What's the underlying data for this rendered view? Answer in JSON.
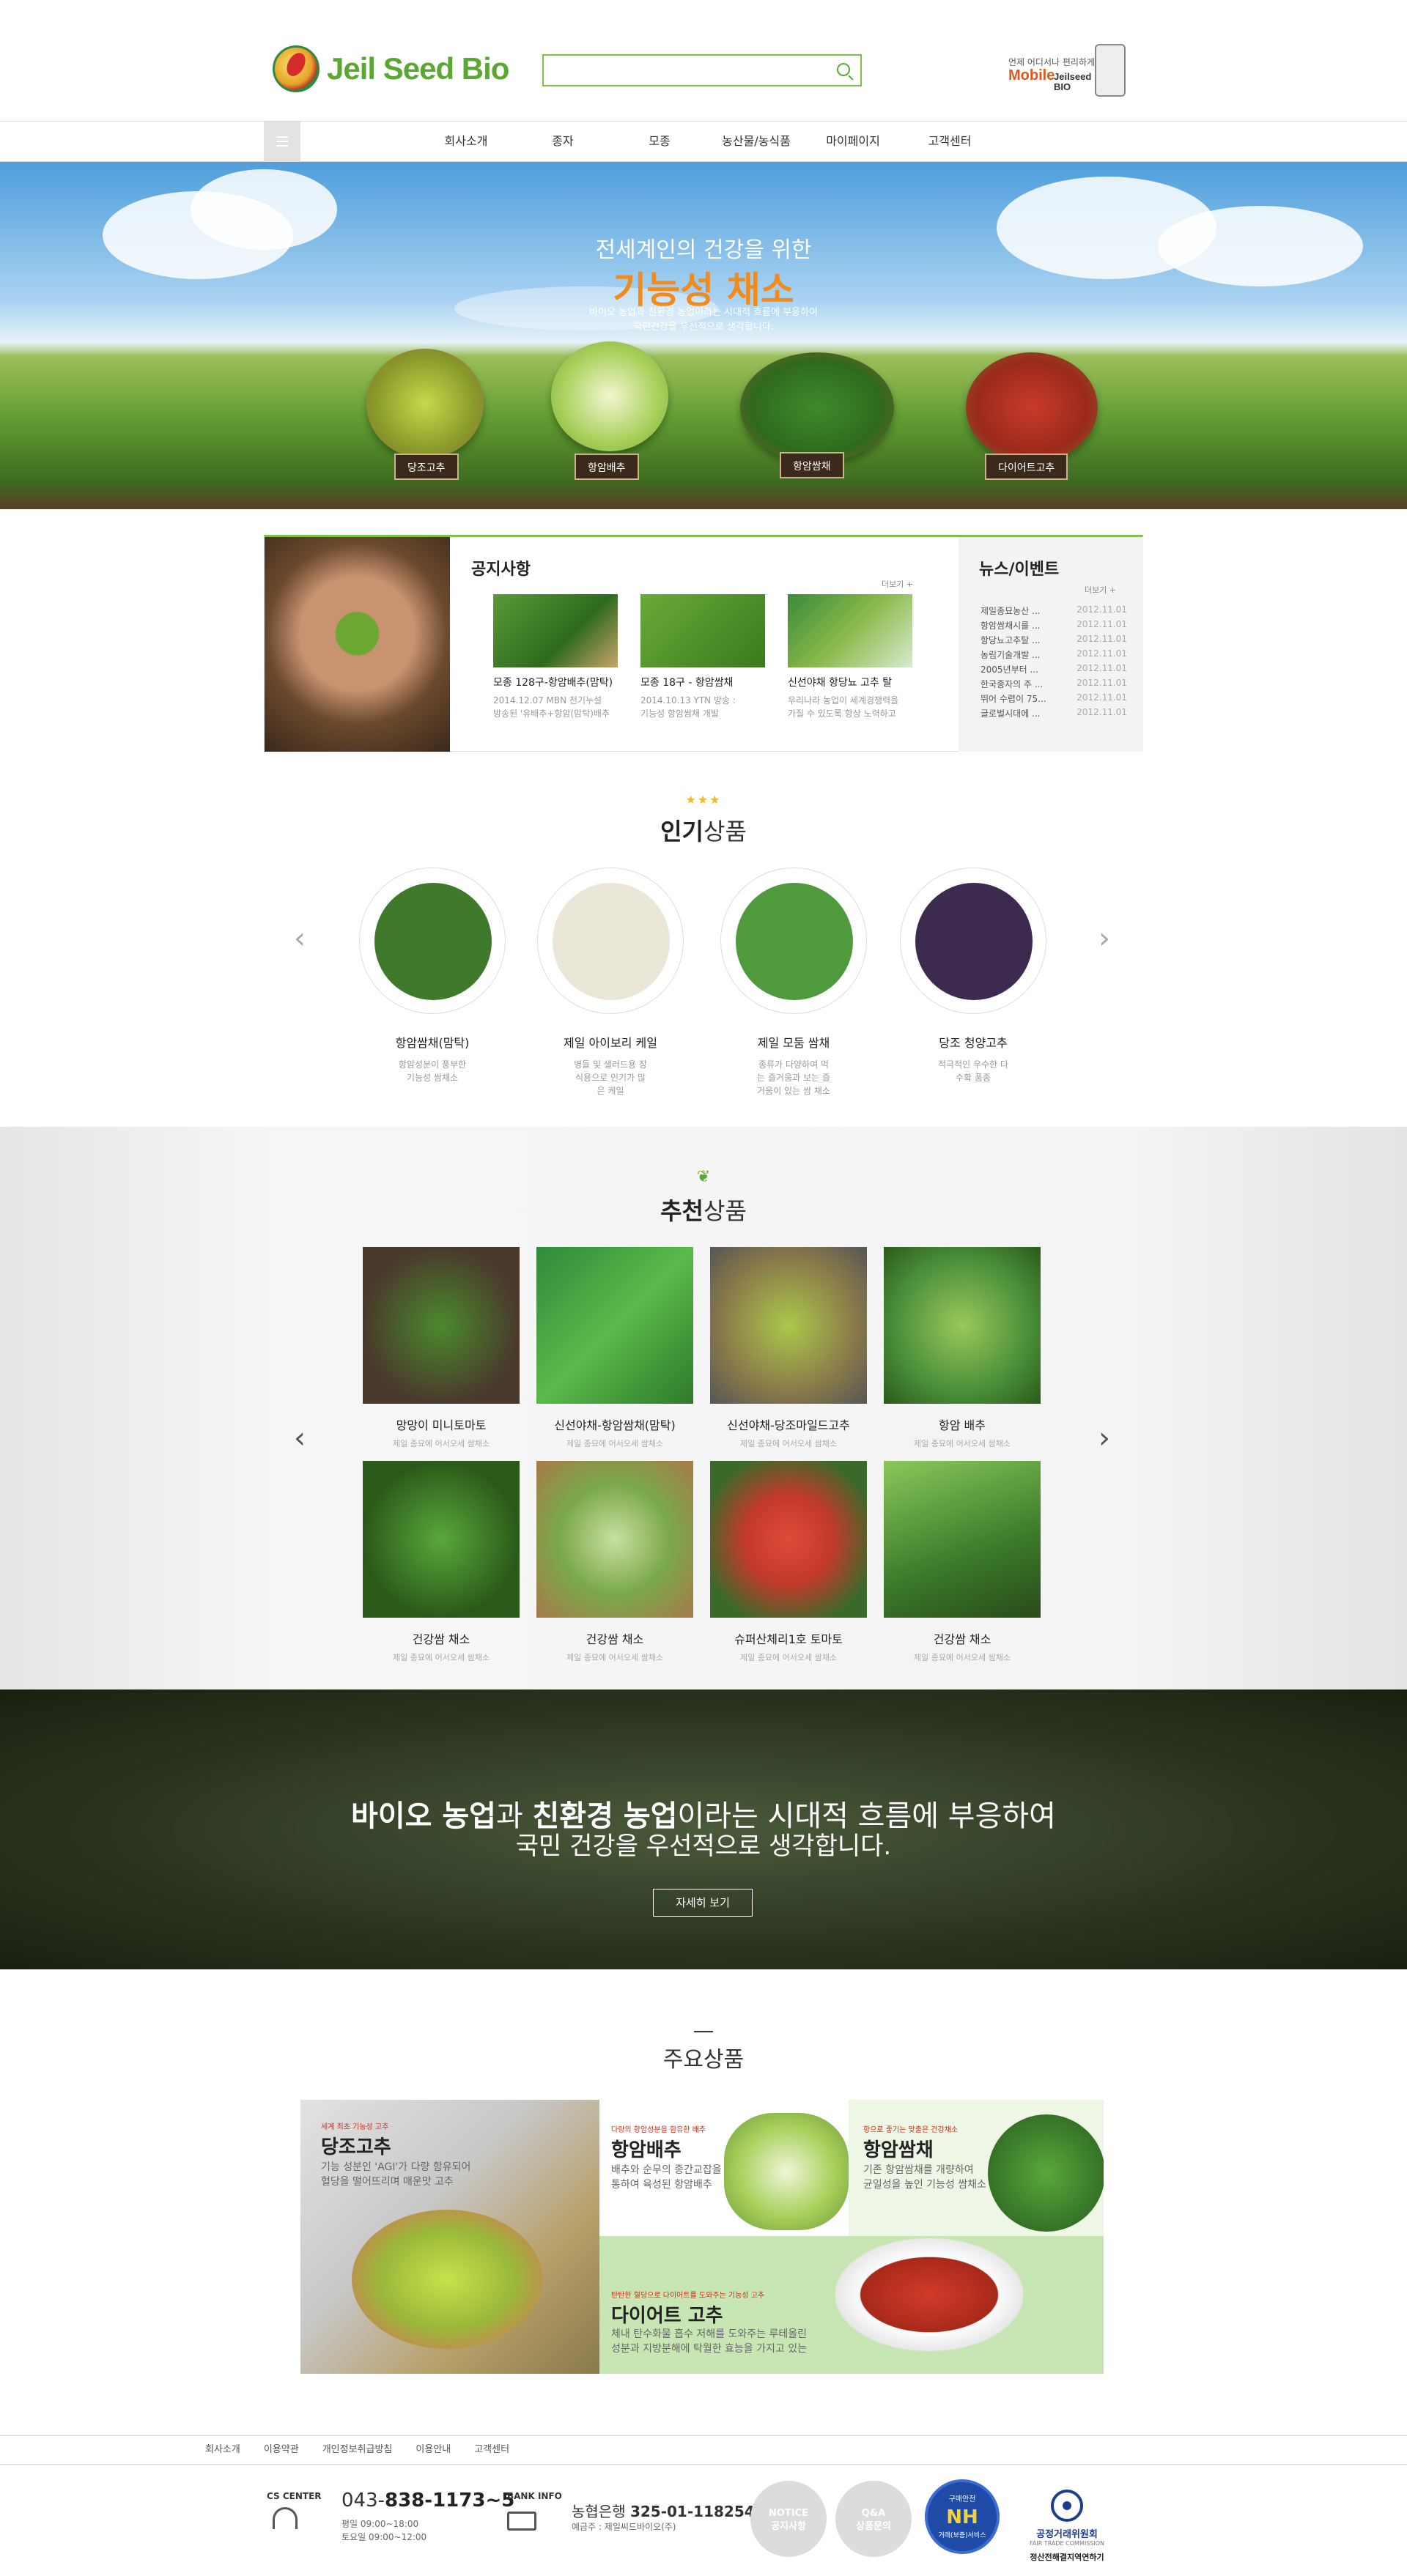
{
  "header": {
    "logo_text": "Jeil Seed Bio",
    "search_placeholder": "",
    "mobile": {
      "line1": "언제 어디서나 편리하게",
      "line2": "Mobile",
      "line3": "Jeilseed BIO"
    }
  },
  "nav": {
    "items": [
      "회사소개",
      "종자",
      "모종",
      "농산물/농식품",
      "마이페이지",
      "고객센터"
    ]
  },
  "hero": {
    "subtitle": "전세계인의 건강을 위한",
    "title": "기능성 채소",
    "desc1": "바이오 농업과 친환경 농업이라는 시대적 흐름에 부응하여",
    "desc2": "국민건강을 우선적으로 생각합니다.",
    "veg_labels": [
      "당조고추",
      "항암배추",
      "항암쌈채",
      "다이어트고추"
    ]
  },
  "notice": {
    "title": "공지사항",
    "more": "더보기 +",
    "cards": [
      {
        "title": "모종 128구-항암배추(맘탁)",
        "desc1": "2014.12.07 MBN 천기누설",
        "desc2": "방송된 '유배추+항암(맘탁)배추"
      },
      {
        "title": "모종 18구 - 항암쌈채",
        "desc1": "2014.10.13 YTN 방송 :",
        "desc2": "기능성 항암쌈채 개발"
      },
      {
        "title": "신선야채 항당뇨 고추 탈",
        "desc1": "우리나라 농업이 세계경쟁력을",
        "desc2": "가질 수 있도록 항상 노력하고"
      }
    ]
  },
  "news": {
    "title": "뉴스/이벤트",
    "more": "더보기 +",
    "items": [
      {
        "text": "제일종묘농산 ...",
        "date": "2012.11.01"
      },
      {
        "text": "항암쌈채시를 ...",
        "date": "2012.11.01"
      },
      {
        "text": "항당뇨고추탈 ...",
        "date": "2012.11.01"
      },
      {
        "text": "농림기술개발 ...",
        "date": "2012.11.01"
      },
      {
        "text": "2005년부터 ...",
        "date": "2012.11.01"
      },
      {
        "text": "한국종자의 주 ...",
        "date": "2012.11.01"
      },
      {
        "text": "뛰어 수렵이 75...",
        "date": "2012.11.01"
      },
      {
        "text": "글로벌시대에 ...",
        "date": "2012.11.01"
      }
    ]
  },
  "popular": {
    "title_bold": "인기",
    "title_rest": "상품",
    "items": [
      {
        "name": "항암쌈채(맘탁)",
        "desc": "항암성분이 풍부한 기능성 쌈채소",
        "color": "#3f7a2c"
      },
      {
        "name": "제일 아이보리 케일",
        "desc": "병들 및 샐러드용 장식용으로 인기가 많은 케일",
        "color": "#eae6d8"
      },
      {
        "name": "제일 모둠 쌈채",
        "desc": "종류가 다양하여 먹는 즐거움과 보는 즐거움이 있는 쌈 채소",
        "color": "#4f9a3c"
      },
      {
        "name": "당조 청양고추",
        "desc": "적극적인 우수한 다수확 품종",
        "color": "#3d2a4f"
      }
    ]
  },
  "recommend": {
    "title_bold": "추천",
    "title_rest": "상품",
    "sub": "제일 종묘에 어서오세 쌈채소",
    "items": [
      {
        "name": "망망이 미니토마토",
        "color": "#4a3a2c"
      },
      {
        "name": "신선야채-항암쌈채(맘탁)",
        "color": "#2e8a3a"
      },
      {
        "name": "신선야채-당조마일드고추",
        "color": "#8aa23a"
      },
      {
        "name": "항암 배추",
        "color": "#4a8f3a"
      },
      {
        "name": "건강쌈 채소",
        "color": "#3c7a2a"
      },
      {
        "name": "건강쌈 채소",
        "color": "#7aa84a"
      },
      {
        "name": "슈퍼산체리1호 토마토",
        "color": "#c23a2a"
      },
      {
        "name": "건강쌈 채소",
        "color": "#5a9a3a"
      }
    ]
  },
  "banner": {
    "bold1": "바이오 농업",
    "mid1": "과 ",
    "bold2": "친환경 농업",
    "rest1": "이라는 시대적 흐름에 부응하여",
    "line2": "국민 건강을 우선적으로 생각합니다.",
    "button": "자세히 보기"
  },
  "main_products": {
    "title": "주요상품",
    "items": [
      {
        "tag": "세계 최초 기능성 고추",
        "name": "당조고추",
        "desc1": "기능 성분인 'AGI'가 다량 함유되어",
        "desc2": "혈당을 떨어뜨리며 매운맛 고추"
      },
      {
        "tag": "다량의 항암성분을 함유한 배추",
        "name": "항암배추",
        "desc1": "배추와 순무의 종간교잡을",
        "desc2": "통하여 육성된 항암배추"
      },
      {
        "tag": "항으로 좋기는 맞출은 건강채소",
        "name": "항암쌈채",
        "desc1": "기존 항암쌈채를 개량하여",
        "desc2": "균일성을 높인 기능성 쌈채소"
      },
      {
        "tag": "탄탄한 혈당으로 다이어트를 도와주는 기능성 고추",
        "name": "다이어트 고추",
        "desc1": "체내 탄수화물 흡수 저해를 도와주는 루테올린",
        "desc2": "성분과 지방분해에 탁월한 효능을 가지고 있는"
      }
    ]
  },
  "footer": {
    "links": [
      "회사소개",
      "이용약관",
      "개인정보취급방침",
      "이용안내",
      "고객센터"
    ],
    "cs_label": "CS CENTER",
    "tel_prefix": "043-",
    "tel_main": "838-1173~5",
    "hours1": "평일 09:00~18:00",
    "hours2": "토요일 09:00~12:00",
    "bank_label": "BANK INFO",
    "bank_name": "농협은행 ",
    "bank_account": "325-01-118254",
    "bank_holder": "예금주 : 제일씨드바이오(주)",
    "notice_btn1": "NOTICE",
    "notice_btn2": "공지사항",
    "qa_btn1": "Q&A",
    "qa_btn2": "상품문의",
    "nh1": "구매안전",
    "nh2": "NH",
    "nh3": "거래(보증)서비스",
    "ftc1": "공정거래위원회",
    "ftc2": "FAIR TRADE COMMISSION",
    "ftc3": "정산전해결지역연하기"
  }
}
